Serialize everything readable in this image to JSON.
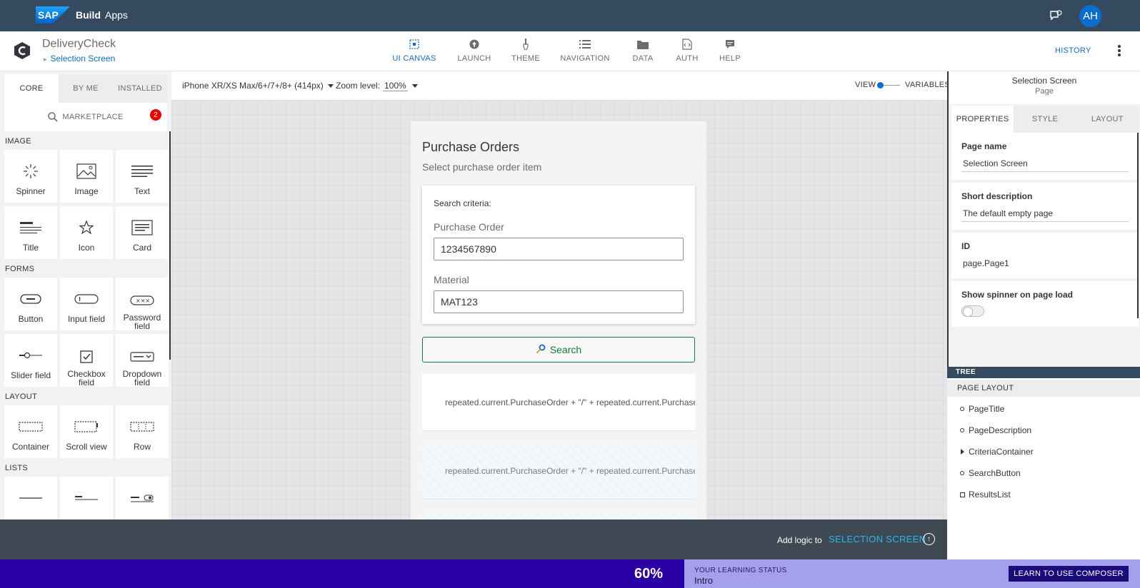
{
  "topbar": {
    "brand_name": "Build",
    "brand_product": "Apps",
    "avatar_initials": "AH"
  },
  "header": {
    "app_name": "DeliveryCheck",
    "current_page": "Selection Screen",
    "tabs": [
      {
        "label": "UI CANVAS",
        "icon": "ui-canvas-icon",
        "active": true
      },
      {
        "label": "LAUNCH",
        "icon": "launch-icon"
      },
      {
        "label": "THEME",
        "icon": "theme-brush-icon"
      },
      {
        "label": "NAVIGATION",
        "icon": "navigation-list-icon"
      },
      {
        "label": "DATA",
        "icon": "folder-icon"
      },
      {
        "label": "AUTH",
        "icon": "code-file-icon"
      },
      {
        "label": "HELP",
        "icon": "help-chat-icon"
      }
    ],
    "history_label": "HISTORY"
  },
  "left_panel": {
    "tabs": [
      "CORE",
      "BY ME",
      "INSTALLED"
    ],
    "marketplace_label": "MARKETPLACE",
    "marketplace_badge": "2",
    "sections": [
      {
        "title": "IMAGE",
        "items": [
          "Spinner",
          "Image",
          "Text",
          "Title",
          "Icon",
          "Card"
        ]
      },
      {
        "title": "FORMS",
        "items": [
          "Button",
          "Input field",
          "Password field",
          "Slider field",
          "Checkbox field",
          "Dropdown field"
        ]
      },
      {
        "title": "LAYOUT",
        "items": [
          "Container",
          "Scroll view",
          "Row"
        ]
      },
      {
        "title": "LISTS",
        "items": []
      }
    ]
  },
  "canvas_toolbar": {
    "device": "iPhone XR/XS Max/6+/7+/8+ (414px)",
    "zoom_label": "Zoom level:",
    "zoom_value": "100%",
    "view_label": "VIEW",
    "variables_label": "VARIABLES"
  },
  "phone": {
    "title": "Purchase Orders",
    "description": "Select purchase order item",
    "criteria_label": "Search criteria:",
    "po_label": "Purchase Order",
    "po_value": "1234567890",
    "material_label": "Material",
    "material_value": "MAT123",
    "search_button": "Search",
    "result_text": "repeated.current.PurchaseOrder + \"/\" + repeated.current.PurchaseOrderItem"
  },
  "right_panel": {
    "title": "Selection Screen",
    "subtitle": "Page",
    "tabs": [
      "PROPERTIES",
      "STYLE",
      "LAYOUT"
    ],
    "page_name_label": "Page name",
    "page_name_value": "Selection Screen",
    "short_desc_label": "Short description",
    "short_desc_value": "The default empty page",
    "id_label": "ID",
    "id_value": "page.Page1",
    "spinner_label": "Show spinner on page load"
  },
  "tree": {
    "header": "TREE",
    "root": "PAGE LAYOUT",
    "nodes": [
      "PageTitle",
      "PageDescription",
      "CriteriaContainer",
      "SearchButton",
      "ResultsList"
    ]
  },
  "logic_bar": {
    "text": "Add logic to",
    "link": "SELECTION SCREEN"
  },
  "learning": {
    "percent": "60%",
    "status_label": "YOUR LEARNING STATUS",
    "status_value": "Intro",
    "button": "LEARN TO USE COMPOSER"
  },
  "colors": {
    "shell": "#354a5f",
    "accent": "#0a6ed1",
    "success": "#107e3e",
    "learn_bar": "#2a00a5",
    "learn_panel": "#a5a0ec"
  }
}
